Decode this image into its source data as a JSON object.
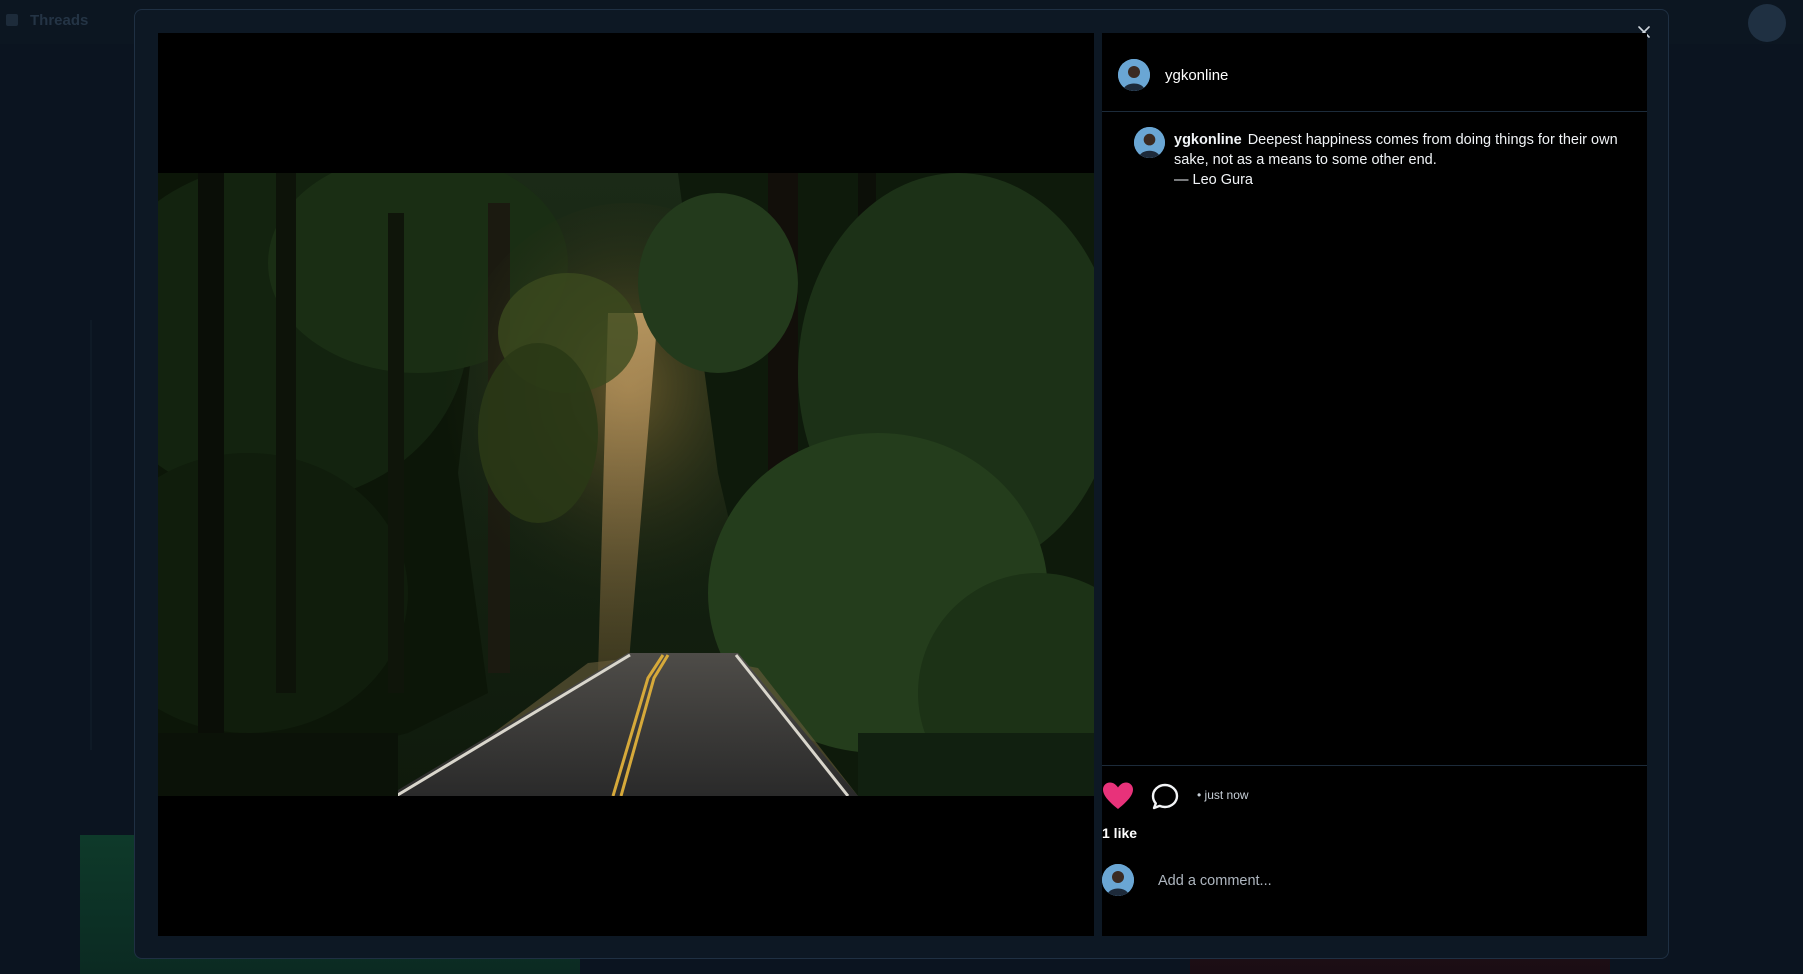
{
  "background_app": {
    "title": "Threads"
  },
  "post": {
    "username": "ygkonline",
    "caption": "Deepest happiness comes from doing things for their own sake, not as a means to some other end.",
    "caption_attribution": "— Leo Gura",
    "timestamp": "• just now",
    "likes_text": "1 like",
    "liked": true,
    "image_subject": "sunlit forest road through redwoods"
  },
  "comment_box": {
    "placeholder": "Add a comment..."
  },
  "icons": {
    "close": "close-icon",
    "like": "heart-icon",
    "comment": "comment-icon"
  },
  "colors": {
    "heart": "#e8327a",
    "modal_bg": "#0d1824",
    "pane_bg": "#000000"
  }
}
